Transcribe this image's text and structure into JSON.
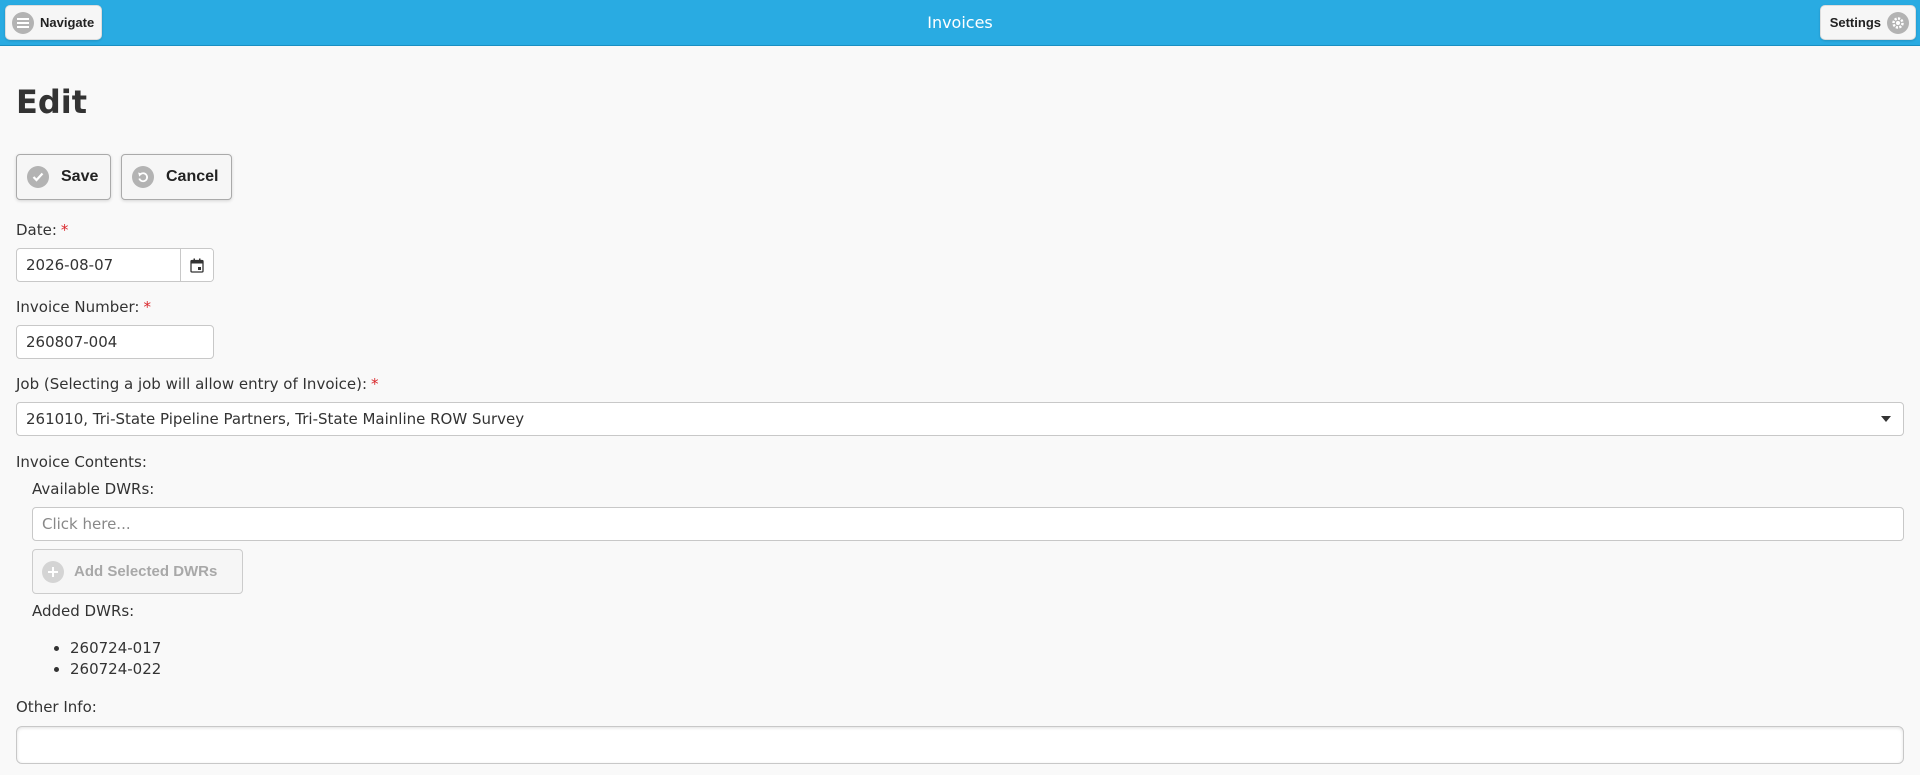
{
  "header": {
    "title": "Invoices",
    "navigate_label": "Navigate",
    "settings_label": "Settings"
  },
  "page": {
    "title": "Edit"
  },
  "actions": {
    "save_label": "Save",
    "cancel_label": "Cancel"
  },
  "form": {
    "date": {
      "label": "Date:",
      "required_mark": "*",
      "value": "2026-08-07"
    },
    "invoice_number": {
      "label": "Invoice Number:",
      "required_mark": "*",
      "value": "260807-004"
    },
    "job": {
      "label": "Job (Selecting a job will allow entry of Invoice):",
      "required_mark": "*",
      "selected": "261010, Tri-State Pipeline Partners, Tri-State Mainline ROW Survey"
    },
    "invoice_contents_label": "Invoice Contents:",
    "available_dwrs": {
      "label": "Available DWRs:",
      "placeholder": "Click here..."
    },
    "add_selected_label": "Add Selected DWRs",
    "added_dwrs": {
      "label": "Added DWRs:",
      "items": [
        "260724-017",
        "260724-022"
      ]
    },
    "other_info": {
      "label": "Other Info:",
      "value": ""
    }
  },
  "colors": {
    "header_bg": "#29abe2",
    "required": "#d9262b",
    "page_bg": "#f9f9f9"
  }
}
